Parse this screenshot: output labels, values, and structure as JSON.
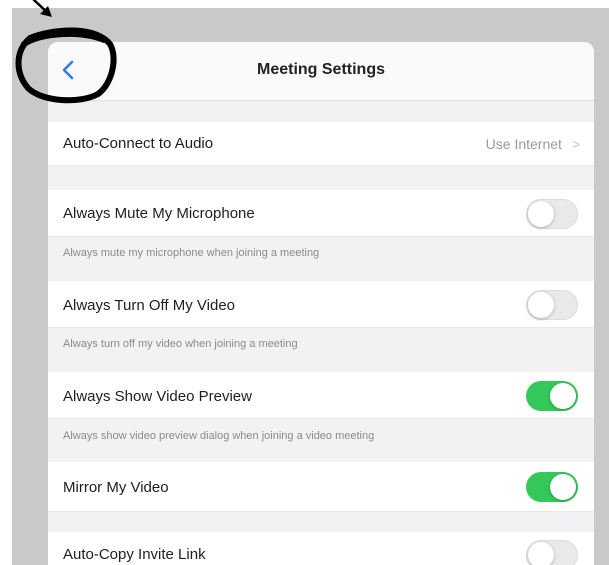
{
  "nav": {
    "title": "Meeting Settings",
    "back_icon": "chevron-left-icon"
  },
  "auto_connect": {
    "label": "Auto-Connect to Audio",
    "value": "Use Internet",
    "chevron": ">"
  },
  "settings": [
    {
      "label": "Always Mute My Microphone",
      "description": "Always mute my microphone when joining a meeting",
      "on": false
    },
    {
      "label": "Always Turn Off My Video",
      "description": "Always turn off my video when joining a meeting",
      "on": false
    },
    {
      "label": "Always Show Video Preview",
      "description": "Always show video preview dialog when joining a video meeting",
      "on": true
    },
    {
      "label": "Mirror My Video",
      "on": true
    },
    {
      "label": "Auto-Copy Invite Link",
      "on": false
    }
  ],
  "colors": {
    "accent": "#2f7cf6",
    "toggle_on": "#34c759",
    "annotation": "#000000"
  }
}
